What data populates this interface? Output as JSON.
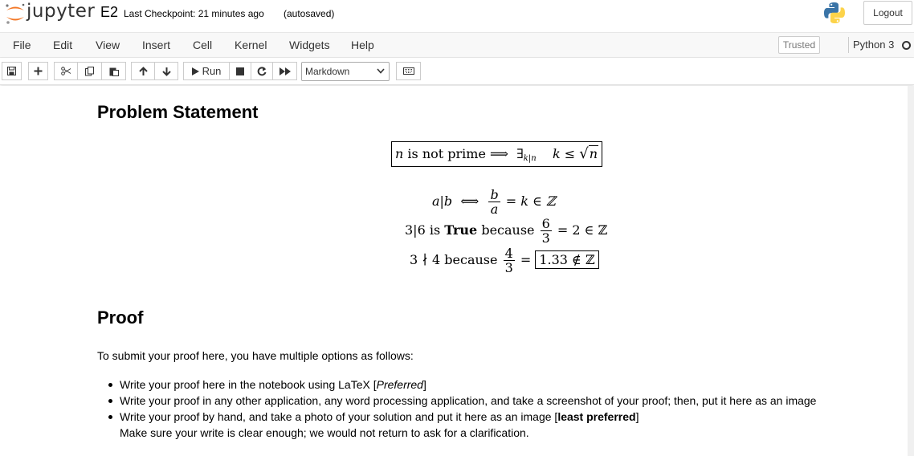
{
  "header": {
    "logo_text": "jupyter",
    "notebook_name": "E2",
    "checkpoint": "Last Checkpoint: 21 minutes ago",
    "autosave": "(autosaved)",
    "logout_label": "Logout"
  },
  "menubar": {
    "items": [
      "File",
      "Edit",
      "View",
      "Insert",
      "Cell",
      "Kernel",
      "Widgets",
      "Help"
    ],
    "trusted": "Trusted",
    "kernel": "Python 3"
  },
  "toolbar": {
    "run_label": "Run",
    "cell_type": "Markdown"
  },
  "cell": {
    "problem_heading": "Problem Statement",
    "eq1": {
      "n": "n",
      "is_not_prime": " is not prime ",
      "implies": "⟹",
      "exists": "∃",
      "sub": "k|n",
      "rhs": "k ≤ ",
      "sqrt_arg": "n"
    },
    "eq2": {
      "lhs": "a|b",
      "iff": "⟺",
      "num": "b",
      "den": "a",
      "rhs": "= k ∈ ℤ"
    },
    "eq3": {
      "lhs": "3|6 is ",
      "bold": "True",
      "mid": " because ",
      "num": "6",
      "den": "3",
      "rhs": "= 2 ∈ ℤ"
    },
    "eq4": {
      "lhs": "3 ∤ 4 because ",
      "num": "4",
      "den": "3",
      "eq": "=",
      "boxed": "1.33 ∉ ℤ"
    },
    "proof_heading": "Proof",
    "intro": "To submit your proof here, you have multiple options as follows:",
    "options": [
      {
        "pre": "Write your proof here in the notebook using LaTeX [",
        "em": "Preferred",
        "post": "]"
      },
      {
        "text": "Write your proof in any other application, any word processing application, and take a screenshot of your proof; then, put it here as an image"
      },
      {
        "pre": "Write your proof by hand, and take a photo of your solution and put it here as an image [",
        "strong": "least preferred",
        "post": "]",
        "line2": "Make sure your write is clear enough; we would not return to ask for a clarification."
      }
    ]
  }
}
